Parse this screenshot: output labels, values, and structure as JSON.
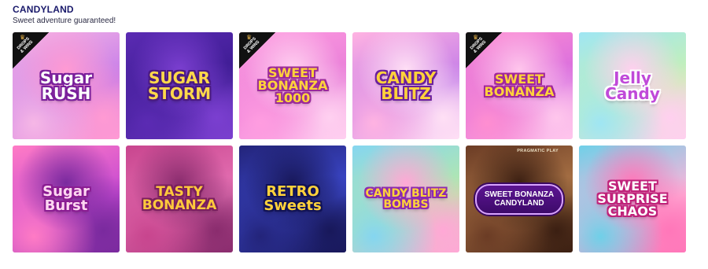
{
  "section": {
    "title": "CANDYLAND",
    "subtitle": "Sweet adventure guaranteed!"
  },
  "badge_text": "DROPS\n& WINS",
  "games": [
    {
      "title": "Sugar\nRUSH",
      "badge": true,
      "bg": [
        "#f6b7e6",
        "#c47ae8",
        "#ff9ad3"
      ],
      "text_color": "#ffffff",
      "outline": "#7a1f9b",
      "font_size": 20
    },
    {
      "title": "SUGAR\nSTORM",
      "badge": false,
      "bg": [
        "#5b2bb3",
        "#3a1a8f",
        "#7b3fd0"
      ],
      "text_color": "#ffd84a",
      "outline": "#4a1a80",
      "font_size": 20
    },
    {
      "title": "SWEET\nBONANZA\n1000",
      "badge": true,
      "bg": [
        "#ff9de0",
        "#e77cd8",
        "#ffd0f0"
      ],
      "text_color": "#ffd23b",
      "outline": "#9b2a9a",
      "font_size": 16
    },
    {
      "title": "CANDY\nBLITZ",
      "badge": false,
      "bg": [
        "#ffb3e2",
        "#c27be8",
        "#ffe0f5"
      ],
      "text_color": "#ffd23b",
      "outline": "#6a1e9e",
      "font_size": 20
    },
    {
      "title": "SWEET\nBONANZA",
      "badge": true,
      "bg": [
        "#ff8ed1",
        "#d56be0",
        "#ffc6ec"
      ],
      "text_color": "#ffd23b",
      "outline": "#a0259d",
      "font_size": 16
    },
    {
      "title": "Jelly\nCandy",
      "badge": false,
      "bg": [
        "#9fe6f3",
        "#c9f1b0",
        "#ffd0ef"
      ],
      "text_color": "#c04ad9",
      "outline": "#ffffff",
      "font_size": 20
    },
    {
      "title": "Sugar\nBurst",
      "badge": false,
      "bg": [
        "#ff7bc5",
        "#c64ad2",
        "#7a2a9e"
      ],
      "text_color": "#ffd7f2",
      "outline": "#8a1c92",
      "font_size": 18
    },
    {
      "title": "TASTY\nBONANZA",
      "badge": false,
      "bg": [
        "#c8458e",
        "#e774b6",
        "#8a2c6e"
      ],
      "text_color": "#ffc93c",
      "outline": "#7a1f5e",
      "font_size": 17
    },
    {
      "title": "RETRO\nSweets",
      "badge": false,
      "bg": [
        "#23247a",
        "#3e4bd1",
        "#18185a"
      ],
      "text_color": "#ffd23b",
      "outline": "#111255",
      "font_size": 18
    },
    {
      "title": "CANDY BLITZ\nBOMBS",
      "badge": false,
      "bg": [
        "#85d6f0",
        "#b8e9a6",
        "#ffa8d6"
      ],
      "text_color": "#ffd23b",
      "outline": "#8c2bb0",
      "font_size": 14
    },
    {
      "title": "SWEET BONANZA\nCANDYLAND",
      "badge": false,
      "plaque": true,
      "provider": "PRAGMATIC PLAY",
      "bg": [
        "#6b3c25",
        "#b27a4a",
        "#3b1f12"
      ],
      "text_color": "#ffffff",
      "outline": "#3a0860",
      "font_size": 10
    },
    {
      "title": "SWEET\nSURPRISE\nCHAOS",
      "badge": false,
      "bg": [
        "#6fd0e8",
        "#ffb3d9",
        "#ff77b9"
      ],
      "text_color": "#ffffff",
      "outline": "#c0227a",
      "font_size": 16
    }
  ]
}
